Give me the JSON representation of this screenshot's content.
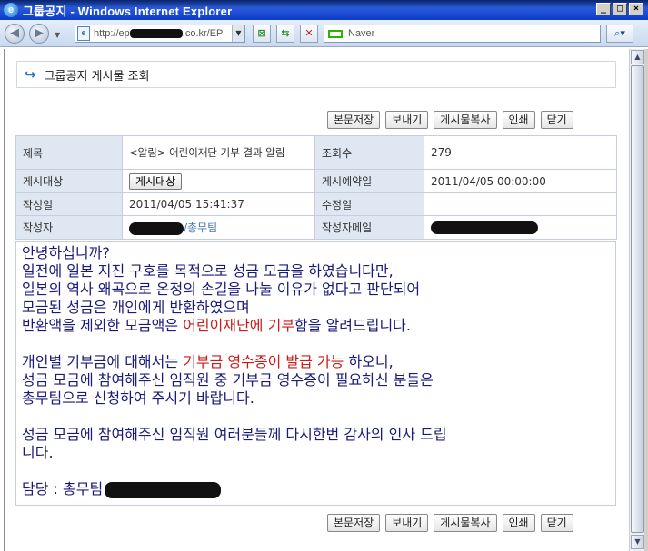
{
  "window": {
    "title": "그룹공지 - Windows Internet Explorer",
    "ie_icon": "ie-logo",
    "controls": [
      "_",
      "□",
      "×"
    ]
  },
  "address_bar": {
    "url_prefix": "http://ep",
    "url_suffix": ".co.kr/EP",
    "search_placeholder": "Naver"
  },
  "page": {
    "header_title": "그룹공지 게시물 조회",
    "buttons": {
      "save": "본문저장",
      "send": "보내기",
      "copy": "게시물복사",
      "print": "인쇄",
      "close": "닫기"
    },
    "fields": {
      "subject_label": "제목",
      "subject_value": "<알림> 어린이재단 기부 결과 알림",
      "views_label": "조회수",
      "views_value": "279",
      "target_label": "게시대상",
      "target_button": "게시대상",
      "reserve_label": "게시예약일",
      "reserve_value": "2011/04/05 00:00:00",
      "created_label": "작성일",
      "created_value": "2011/04/05 15:41:37",
      "modified_label": "수정일",
      "modified_value": "",
      "author_label": "작성자",
      "author_dept": "/총무팀",
      "email_label": "작성자메일"
    },
    "body": {
      "l1": "안녕하십니까?",
      "l2": "일전에 일본 지진 구호를 목적으로 성금 모금을 하였습니다만,",
      "l3": "일본의 역사 왜곡으로 온정의 손길을 나눌 이유가 없다고 판단되어",
      "l4": "모금된 성금은 개인에게 반환하였으며",
      "l5a": "반환액을 제외한 모금액은 ",
      "l5b": "어린이재단에 기부",
      "l5c": "함을 알려드립니다.",
      "l6a": "개인별 기부금에 대해서는 ",
      "l6b": "기부금 영수증이 발급 가능",
      "l6c": " 하오니,",
      "l7": "성금 모금에 참여해주신 임직원 중 기부금 영수증이 필요하신 분들은",
      "l8": "총무팀으로 신청하여 주시기 바랍니다.",
      "l9a": "성금 모금에 참여해주신 임직원 여러분들께 다시한번 ",
      "l9b": "감사의 인사 드립",
      "l10": "니다.",
      "l11": "담당 : 총무팀"
    }
  }
}
